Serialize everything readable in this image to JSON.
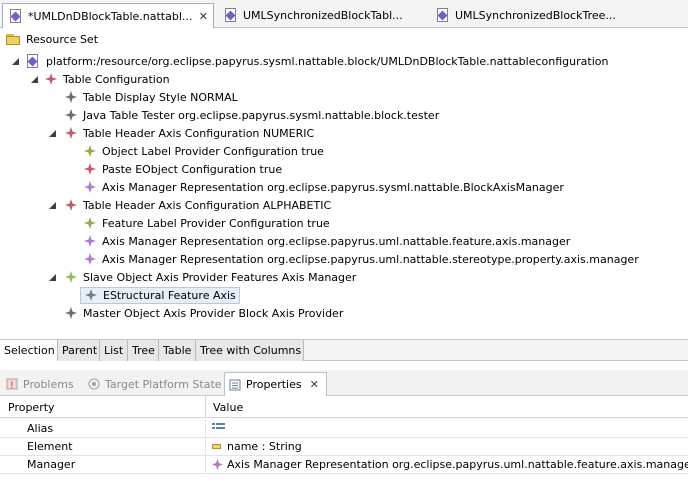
{
  "editor_tabs": [
    {
      "label": "*UMLDnDBlockTable.nattabl...",
      "active": true
    },
    {
      "label": "UMLSynchronizedBlockTabl...",
      "active": false
    },
    {
      "label": "UMLSynchronizedBlockTree...",
      "active": false
    }
  ],
  "resource_set": {
    "label": "Resource Set"
  },
  "tree": {
    "root": "platform:/resource/org.eclipse.papyrus.sysml.nattable.block/UMLDnDBlockTable.nattableconfiguration",
    "table_configuration": "Table Configuration",
    "items": [
      "Table Display Style NORMAL",
      "Java Table Tester org.eclipse.papyrus.sysml.nattable.block.tester",
      "Table Header Axis Configuration NUMERIC",
      "Object Label Provider Configuration true",
      "Paste EObject Configuration true",
      "Axis Manager Representation org.eclipse.papyrus.sysml.nattable.BlockAxisManager",
      "Table Header Axis Configuration ALPHABETIC",
      "Feature Label Provider Configuration true",
      "Axis Manager Representation org.eclipse.papyrus.uml.nattable.feature.axis.manager",
      "Axis Manager Representation org.eclipse.papyrus.uml.nattable.stereotype.property.axis.manager",
      "Slave Object Axis Provider Features Axis Manager",
      "EStructural Feature Axis",
      "Master Object Axis Provider Block Axis Provider"
    ]
  },
  "bottom_tabs": [
    "Selection",
    "Parent",
    "List",
    "Tree",
    "Table",
    "Tree with Columns"
  ],
  "view_tabs": [
    {
      "label": "Problems",
      "active": false
    },
    {
      "label": "Target Platform State",
      "active": false
    },
    {
      "label": "Properties",
      "active": true
    }
  ],
  "properties": {
    "header": {
      "property": "Property",
      "value": "Value"
    },
    "rows": [
      {
        "key": "Alias",
        "value": ""
      },
      {
        "key": "Element",
        "value": "name : String"
      },
      {
        "key": "Manager",
        "value": "Axis Manager Representation org.eclipse.papyrus.uml.nattable.feature.axis.manager"
      }
    ]
  },
  "colors": {
    "gem_purple": "#b07cc6",
    "gem_green": "#8fbf5a",
    "gem_red": "#c85a6e",
    "gem_gray": "#6e6e6e",
    "accent_blue": "#b9c3d0"
  }
}
